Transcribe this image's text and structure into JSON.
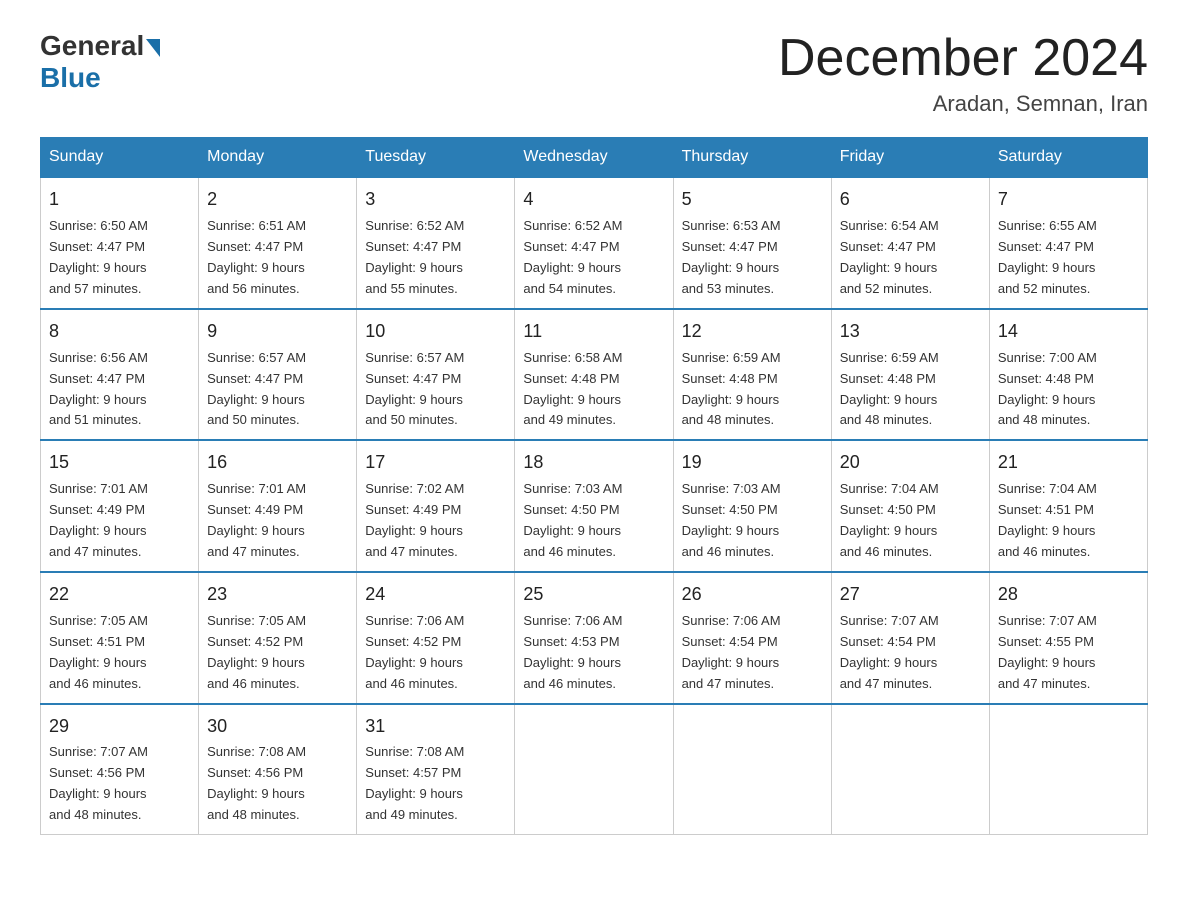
{
  "logo": {
    "general": "General",
    "blue": "Blue"
  },
  "title": "December 2024",
  "location": "Aradan, Semnan, Iran",
  "days_of_week": [
    "Sunday",
    "Monday",
    "Tuesday",
    "Wednesday",
    "Thursday",
    "Friday",
    "Saturday"
  ],
  "weeks": [
    [
      {
        "day": "1",
        "sunrise": "6:50 AM",
        "sunset": "4:47 PM",
        "daylight": "9 hours and 57 minutes."
      },
      {
        "day": "2",
        "sunrise": "6:51 AM",
        "sunset": "4:47 PM",
        "daylight": "9 hours and 56 minutes."
      },
      {
        "day": "3",
        "sunrise": "6:52 AM",
        "sunset": "4:47 PM",
        "daylight": "9 hours and 55 minutes."
      },
      {
        "day": "4",
        "sunrise": "6:52 AM",
        "sunset": "4:47 PM",
        "daylight": "9 hours and 54 minutes."
      },
      {
        "day": "5",
        "sunrise": "6:53 AM",
        "sunset": "4:47 PM",
        "daylight": "9 hours and 53 minutes."
      },
      {
        "day": "6",
        "sunrise": "6:54 AM",
        "sunset": "4:47 PM",
        "daylight": "9 hours and 52 minutes."
      },
      {
        "day": "7",
        "sunrise": "6:55 AM",
        "sunset": "4:47 PM",
        "daylight": "9 hours and 52 minutes."
      }
    ],
    [
      {
        "day": "8",
        "sunrise": "6:56 AM",
        "sunset": "4:47 PM",
        "daylight": "9 hours and 51 minutes."
      },
      {
        "day": "9",
        "sunrise": "6:57 AM",
        "sunset": "4:47 PM",
        "daylight": "9 hours and 50 minutes."
      },
      {
        "day": "10",
        "sunrise": "6:57 AM",
        "sunset": "4:47 PM",
        "daylight": "9 hours and 50 minutes."
      },
      {
        "day": "11",
        "sunrise": "6:58 AM",
        "sunset": "4:48 PM",
        "daylight": "9 hours and 49 minutes."
      },
      {
        "day": "12",
        "sunrise": "6:59 AM",
        "sunset": "4:48 PM",
        "daylight": "9 hours and 48 minutes."
      },
      {
        "day": "13",
        "sunrise": "6:59 AM",
        "sunset": "4:48 PM",
        "daylight": "9 hours and 48 minutes."
      },
      {
        "day": "14",
        "sunrise": "7:00 AM",
        "sunset": "4:48 PM",
        "daylight": "9 hours and 48 minutes."
      }
    ],
    [
      {
        "day": "15",
        "sunrise": "7:01 AM",
        "sunset": "4:49 PM",
        "daylight": "9 hours and 47 minutes."
      },
      {
        "day": "16",
        "sunrise": "7:01 AM",
        "sunset": "4:49 PM",
        "daylight": "9 hours and 47 minutes."
      },
      {
        "day": "17",
        "sunrise": "7:02 AM",
        "sunset": "4:49 PM",
        "daylight": "9 hours and 47 minutes."
      },
      {
        "day": "18",
        "sunrise": "7:03 AM",
        "sunset": "4:50 PM",
        "daylight": "9 hours and 46 minutes."
      },
      {
        "day": "19",
        "sunrise": "7:03 AM",
        "sunset": "4:50 PM",
        "daylight": "9 hours and 46 minutes."
      },
      {
        "day": "20",
        "sunrise": "7:04 AM",
        "sunset": "4:50 PM",
        "daylight": "9 hours and 46 minutes."
      },
      {
        "day": "21",
        "sunrise": "7:04 AM",
        "sunset": "4:51 PM",
        "daylight": "9 hours and 46 minutes."
      }
    ],
    [
      {
        "day": "22",
        "sunrise": "7:05 AM",
        "sunset": "4:51 PM",
        "daylight": "9 hours and 46 minutes."
      },
      {
        "day": "23",
        "sunrise": "7:05 AM",
        "sunset": "4:52 PM",
        "daylight": "9 hours and 46 minutes."
      },
      {
        "day": "24",
        "sunrise": "7:06 AM",
        "sunset": "4:52 PM",
        "daylight": "9 hours and 46 minutes."
      },
      {
        "day": "25",
        "sunrise": "7:06 AM",
        "sunset": "4:53 PM",
        "daylight": "9 hours and 46 minutes."
      },
      {
        "day": "26",
        "sunrise": "7:06 AM",
        "sunset": "4:54 PM",
        "daylight": "9 hours and 47 minutes."
      },
      {
        "day": "27",
        "sunrise": "7:07 AM",
        "sunset": "4:54 PM",
        "daylight": "9 hours and 47 minutes."
      },
      {
        "day": "28",
        "sunrise": "7:07 AM",
        "sunset": "4:55 PM",
        "daylight": "9 hours and 47 minutes."
      }
    ],
    [
      {
        "day": "29",
        "sunrise": "7:07 AM",
        "sunset": "4:56 PM",
        "daylight": "9 hours and 48 minutes."
      },
      {
        "day": "30",
        "sunrise": "7:08 AM",
        "sunset": "4:56 PM",
        "daylight": "9 hours and 48 minutes."
      },
      {
        "day": "31",
        "sunrise": "7:08 AM",
        "sunset": "4:57 PM",
        "daylight": "9 hours and 49 minutes."
      },
      null,
      null,
      null,
      null
    ]
  ],
  "labels": {
    "sunrise": "Sunrise:",
    "sunset": "Sunset:",
    "daylight": "Daylight:"
  }
}
